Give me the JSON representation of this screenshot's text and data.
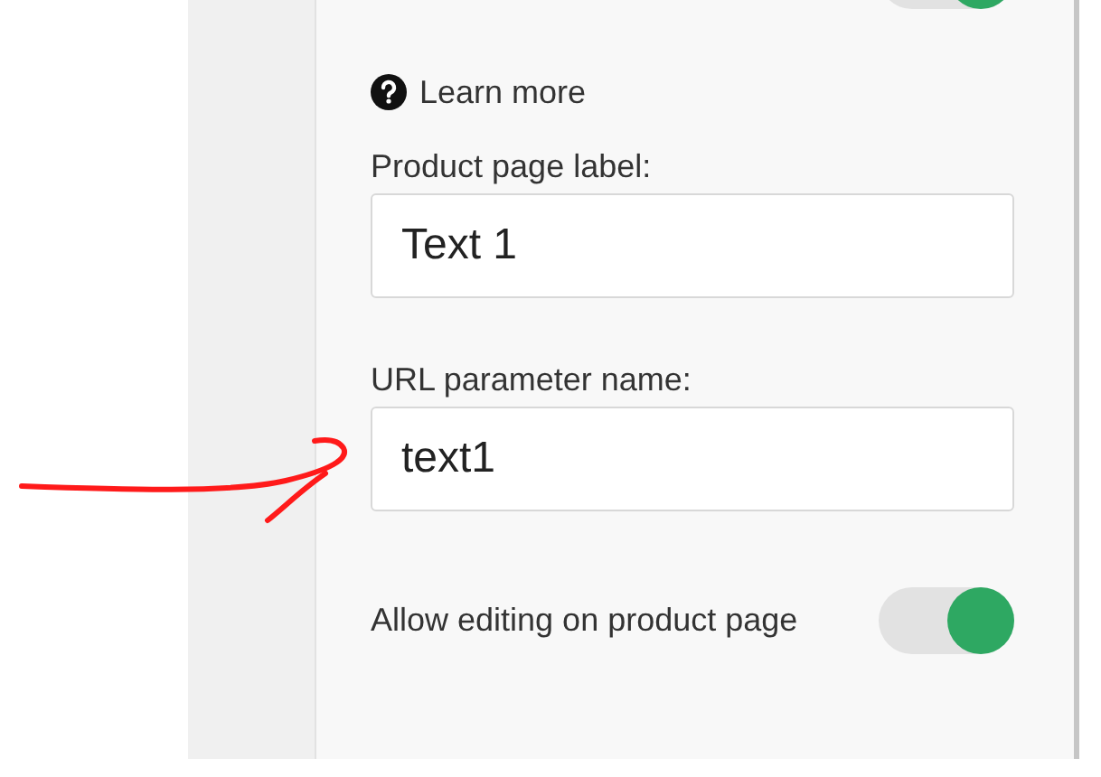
{
  "top_toggle": {
    "on": true
  },
  "help_link": {
    "label": "Learn more"
  },
  "fields": [
    {
      "label": "Product page label:",
      "value": "Text 1"
    },
    {
      "label": "URL parameter name:",
      "value": "text1"
    }
  ],
  "allow_editing": {
    "label": "Allow editing on product page",
    "on": true
  }
}
